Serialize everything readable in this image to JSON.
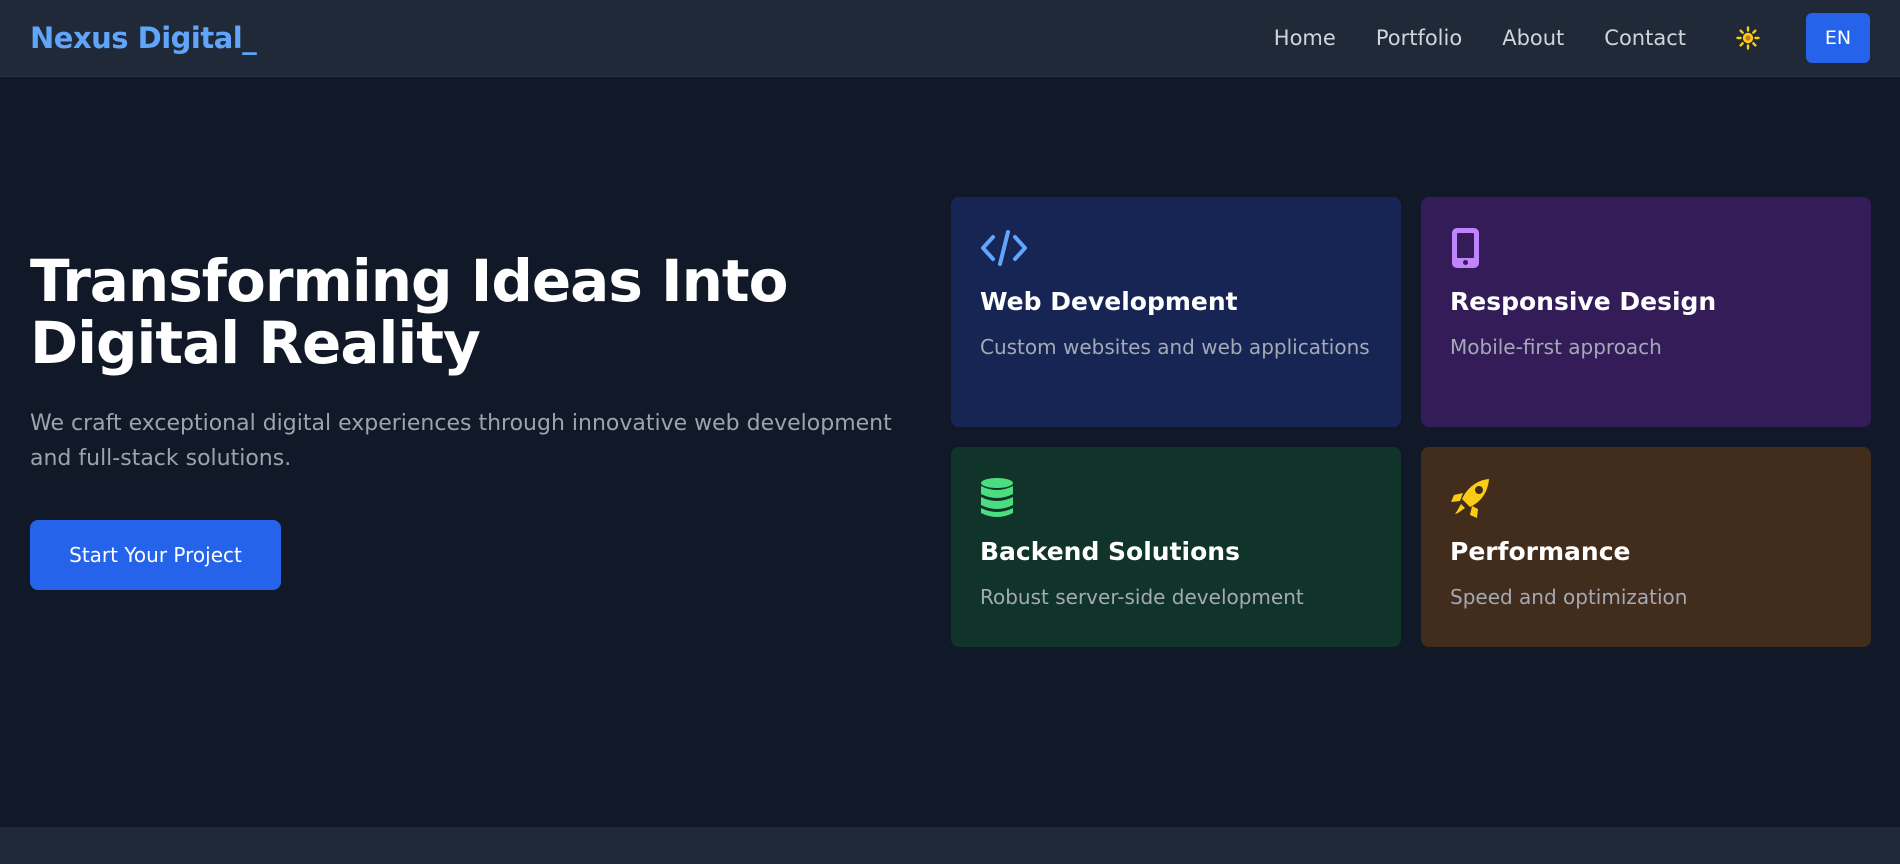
{
  "brand": "Nexus Digital_",
  "nav": {
    "links": [
      "Home",
      "Portfolio",
      "About",
      "Contact"
    ],
    "theme_icon": "sun-icon",
    "language": "EN"
  },
  "hero": {
    "title_line1": "Transforming Ideas Into",
    "title_line2": "Digital Reality",
    "subtitle": "We craft exceptional digital experiences through innovative web development and full-stack solutions.",
    "cta": "Start Your Project"
  },
  "features": [
    {
      "icon": "code-icon",
      "title": "Web Development",
      "description": "Custom websites and web applications",
      "bg": "#172554",
      "accent": "#60a5fa"
    },
    {
      "icon": "mobile-icon",
      "title": "Responsive Design",
      "description": "Mobile-first approach",
      "bg": "#341c59",
      "accent": "#c084fc"
    },
    {
      "icon": "database-icon",
      "title": "Backend Solutions",
      "description": "Robust server-side development",
      "bg": "#11342a",
      "accent": "#4ade80"
    },
    {
      "icon": "rocket-icon",
      "title": "Performance",
      "description": "Speed and optimization",
      "bg": "#422c1c",
      "accent": "#facc15"
    }
  ],
  "colors": {
    "page_bg": "#111827",
    "nav_bg": "#1f2937",
    "brand": "#60a5fa",
    "primary": "#2563eb",
    "muted_text": "#9ca3af",
    "sun": "#facc15"
  }
}
